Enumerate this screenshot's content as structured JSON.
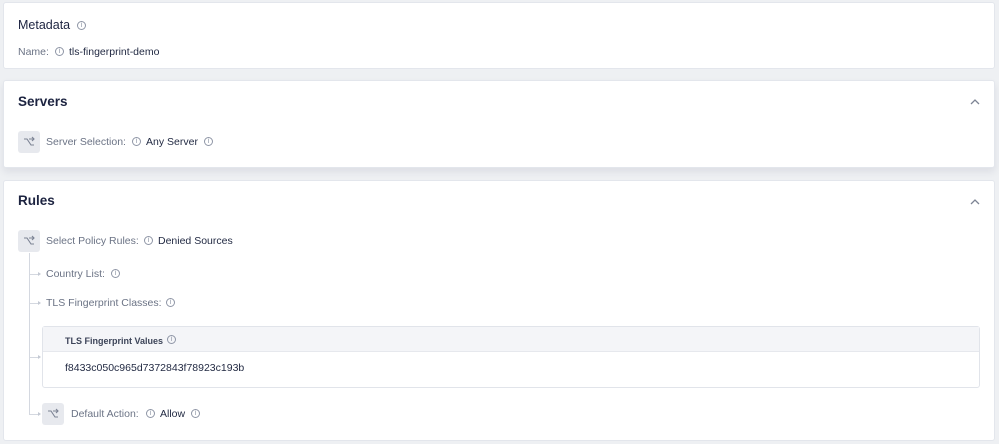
{
  "metadata": {
    "title": "Metadata",
    "name_label": "Name:",
    "name_value": "tls-fingerprint-demo"
  },
  "servers": {
    "title": "Servers",
    "selection_label": "Server Selection:",
    "selection_value": "Any Server"
  },
  "rules": {
    "title": "Rules",
    "policy_rules_label": "Select Policy Rules:",
    "policy_rules_value": "Denied Sources",
    "country_list_label": "Country List:",
    "tls_classes_label": "TLS Fingerprint Classes:",
    "tls_values_header": "TLS Fingerprint Values",
    "tls_values": [
      "f8433c050c965d7372843f78923c193b"
    ],
    "default_action_label": "Default Action:",
    "default_action_value": "Allow"
  },
  "icons": {
    "info": "info-icon",
    "collapse": "chevron-up-icon",
    "node": "branch-icon"
  },
  "colors": {
    "title": "#1c2340",
    "label": "#6b7385",
    "node_bg": "#e7e9ee",
    "page_bg": "#eef0f3"
  }
}
